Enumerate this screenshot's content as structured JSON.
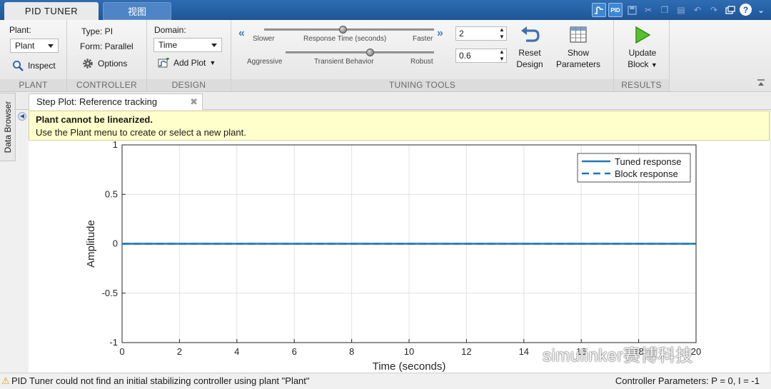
{
  "tabs": {
    "active": "PID TUNER",
    "inactive": "视图"
  },
  "quick_access": [
    "step-plot-icon",
    "pid-icon",
    "save-icon",
    "cut-icon",
    "copy-icon",
    "paste-icon",
    "undo-icon",
    "redo-icon",
    "restore-icon",
    "help-icon",
    "expand-icon"
  ],
  "plant": {
    "label": "Plant:",
    "selected": "Plant",
    "inspect": "Inspect",
    "section": "PLANT"
  },
  "controller": {
    "type": "Type: PI",
    "form": "Form: Parallel",
    "options": "Options",
    "section": "CONTROLLER"
  },
  "design": {
    "domain_label": "Domain:",
    "domain_value": "Time",
    "add_plot": "Add Plot",
    "section": "DESIGN"
  },
  "tuning": {
    "response_slider": {
      "left": "Slower",
      "center": "Response Time (seconds)",
      "right": "Faster",
      "position": 0.56
    },
    "transient_slider": {
      "left": "Aggressive",
      "center": "Transient Behavior",
      "right": "Robust",
      "position": 0.6
    },
    "response_value": "2",
    "transient_value": "0.6",
    "reset_line1": "Reset",
    "reset_line2": "Design",
    "show_line1": "Show",
    "show_line2": "Parameters",
    "section": "TUNING TOOLS"
  },
  "results": {
    "update_line1": "Update",
    "update_line2": "Block",
    "section": "RESULTS"
  },
  "side_tab": "Data Browser",
  "doc_tab": "Step Plot: Reference tracking",
  "banner": {
    "title": "Plant cannot be linearized.",
    "message": "Use the Plant menu to create or select a new plant."
  },
  "chart_data": {
    "type": "line",
    "xlabel": "Time (seconds)",
    "ylabel": "Amplitude",
    "xlim": [
      0,
      20
    ],
    "ylim": [
      -1,
      1
    ],
    "xticks": [
      0,
      2,
      4,
      6,
      8,
      10,
      12,
      14,
      16,
      18,
      20
    ],
    "yticks": [
      -1,
      -0.5,
      0,
      0.5,
      1
    ],
    "xtick_labels": [
      "0",
      "2",
      "4",
      "6",
      "8",
      "10",
      "12",
      "14",
      "16",
      "18",
      "20"
    ],
    "ytick_labels": [
      "-1",
      "-0.5",
      "0",
      "0.5",
      "1"
    ],
    "grid": true,
    "legend_position": "top-right",
    "series": [
      {
        "name": "Tuned response",
        "style": "solid",
        "color": "#1f77b4",
        "x": [
          0,
          20
        ],
        "y": [
          0,
          0
        ]
      },
      {
        "name": "Block response",
        "style": "dashed",
        "color": "#1f77b4",
        "x": [
          0,
          20
        ],
        "y": [
          0,
          0
        ]
      }
    ]
  },
  "status": {
    "message": "PID Tuner could not find an initial stabilizing controller using plant \"Plant\"",
    "params": "Controller Parameters: P =  0, I = -1"
  },
  "watermark": "simulinker赛博科技"
}
